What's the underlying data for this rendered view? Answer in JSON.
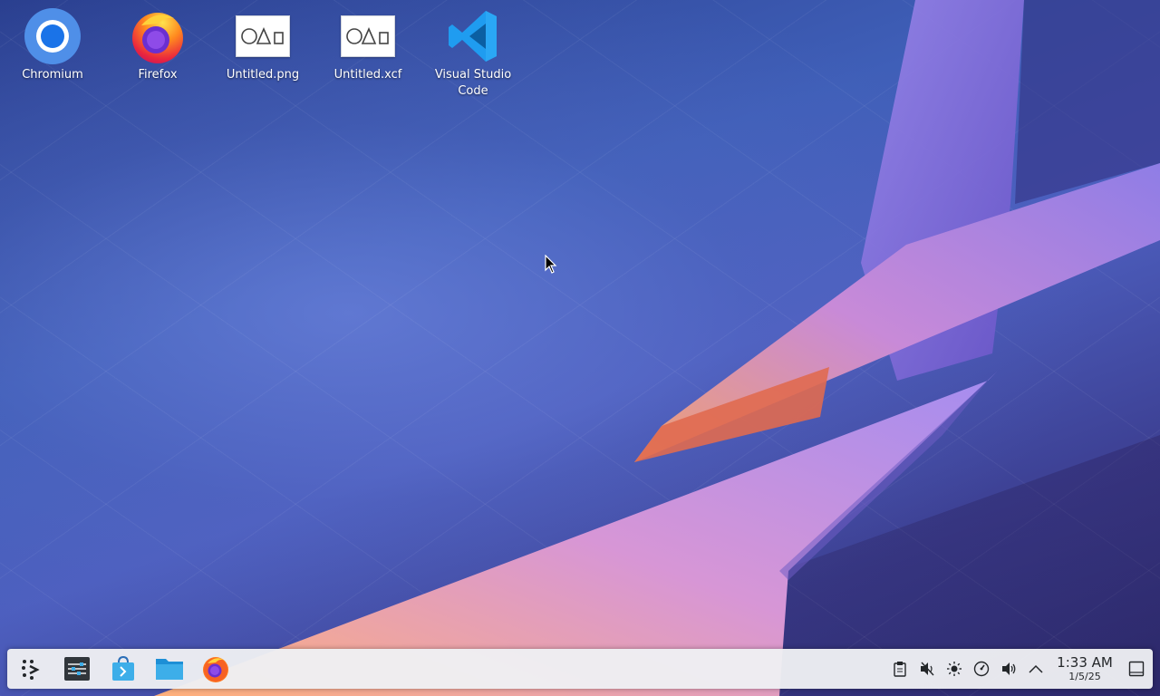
{
  "desktop": {
    "icons": [
      {
        "label": "Chromium",
        "icon": "chromium-icon"
      },
      {
        "label": "Firefox",
        "icon": "firefox-icon"
      },
      {
        "label": "Untitled.png",
        "icon": "image-file-icon"
      },
      {
        "label": "Untitled.xcf",
        "icon": "image-file-icon"
      },
      {
        "label": "Visual Studio Code",
        "icon": "vscode-icon"
      }
    ]
  },
  "taskbar": {
    "launchers": [
      {
        "icon": "application-launcher-icon"
      },
      {
        "icon": "system-settings-icon"
      },
      {
        "icon": "discover-store-icon"
      },
      {
        "icon": "file-manager-icon"
      },
      {
        "icon": "firefox-icon"
      }
    ],
    "tray": [
      {
        "icon": "clipboard-icon"
      },
      {
        "icon": "audio-muted-icon"
      },
      {
        "icon": "brightness-icon"
      },
      {
        "icon": "power-profile-icon"
      },
      {
        "icon": "volume-icon"
      },
      {
        "icon": "chevron-up-icon"
      }
    ],
    "clock": {
      "time": "1:33 AM",
      "date": "1/5/25"
    }
  },
  "colors": {
    "taskbar_bg": "#eeeff2",
    "accent_blue": "#3daee9",
    "vscode_blue": "#1f9cf0"
  }
}
